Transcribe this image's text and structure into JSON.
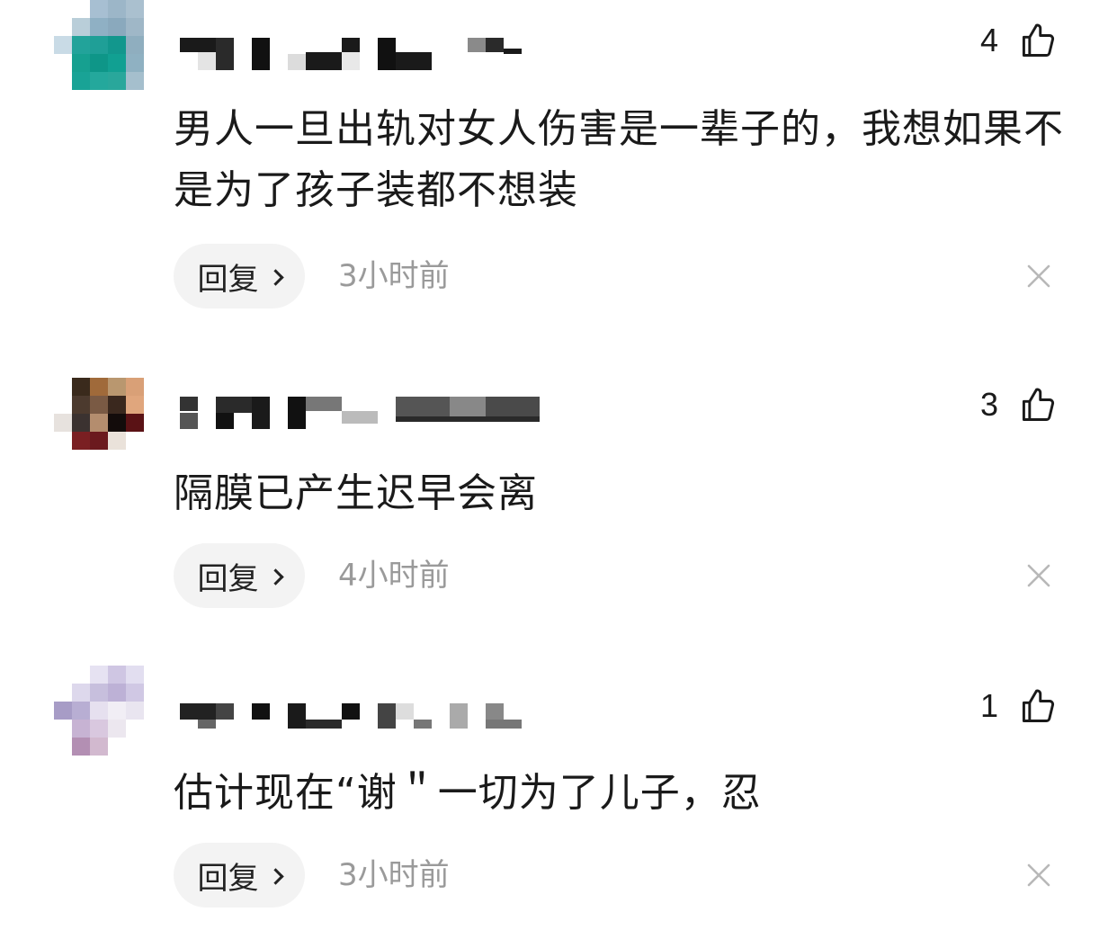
{
  "comments": [
    {
      "likes": "4",
      "text": "男人一旦出轨对女人伤害是一辈子的，我想如果不是为了孩子装都不想装",
      "reply_label": "回复",
      "time": "3小时前"
    },
    {
      "likes": "3",
      "text": "隔膜已产生迟早会离",
      "reply_label": "回复",
      "time": "4小时前"
    },
    {
      "likes": "1",
      "text": "估计现在“谢＂一切为了儿子，忍",
      "reply_label": "回复",
      "time": "3小时前"
    }
  ],
  "icons": {
    "like": "thumbs-up-icon",
    "close": "close-icon",
    "reply_chevron": "chevron-right-icon"
  },
  "colors": {
    "text": "#1a1a1a",
    "secondary_text": "#9a9a9a",
    "reply_pill": "#f3f3f3",
    "close_icon": "#b8b8b8"
  }
}
